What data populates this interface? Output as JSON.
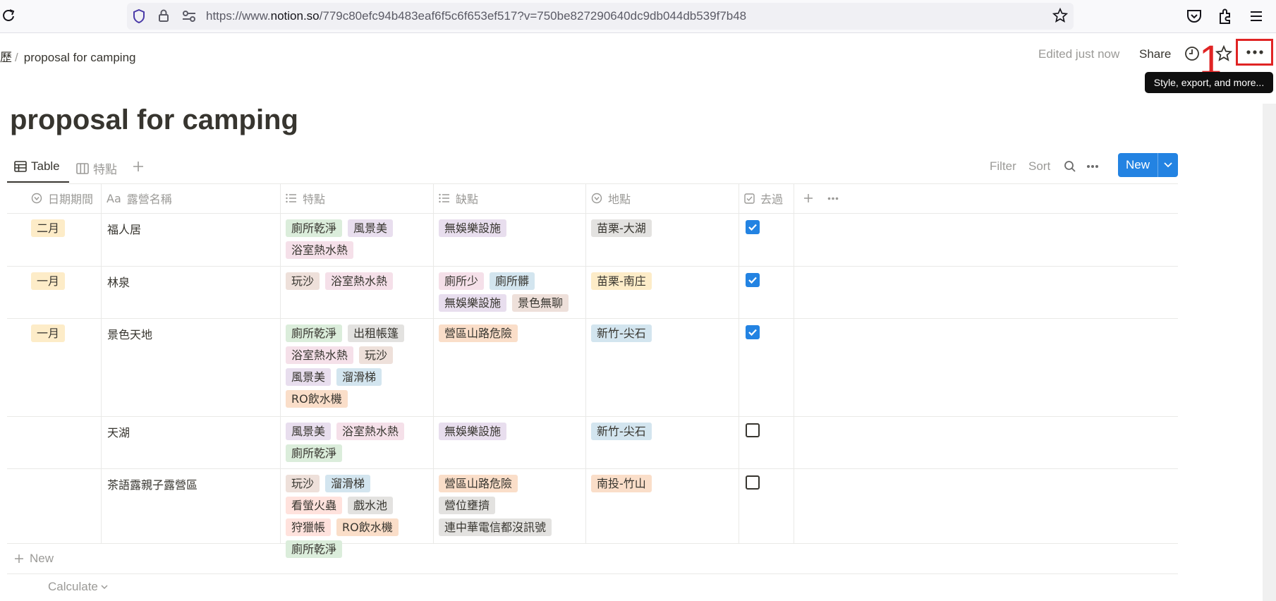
{
  "browser": {
    "url_prefix": "https://www.",
    "url_domain": "notion.so",
    "url_rest": "/779c80efc94b483eaf6f5c6f653ef517?v=750be827290640dc9db044db539f7b48"
  },
  "topbar": {
    "breadcrumb_prefix": "歷",
    "breadcrumb_sep": "/",
    "breadcrumb_page": "proposal for camping",
    "edited": "Edited just now",
    "share": "Share",
    "annotation_number": "1",
    "tooltip": "Style, export, and more..."
  },
  "page": {
    "title": "proposal for camping"
  },
  "views": {
    "tabs": [
      {
        "label": "Table"
      },
      {
        "label": "特點"
      }
    ],
    "filter": "Filter",
    "sort": "Sort",
    "new": "New"
  },
  "columns": [
    {
      "label": "日期期間",
      "icon": "status-icon"
    },
    {
      "label": "露營名稱",
      "icon": "title-icon",
      "prefix": "Aa"
    },
    {
      "label": "特點",
      "icon": "list-icon"
    },
    {
      "label": "缺點",
      "icon": "list-icon"
    },
    {
      "label": "地點",
      "icon": "status-icon"
    },
    {
      "label": "去過",
      "icon": "checkbox-icon"
    }
  ],
  "rows": [
    {
      "date": "二月",
      "name": "福人居",
      "pros": [
        "廁所乾淨",
        "風景美",
        "浴室熱水熱"
      ],
      "cons": [
        "無娛樂設施"
      ],
      "location": "苗栗-大湖",
      "visited": true
    },
    {
      "date": "一月",
      "name": "林泉",
      "pros": [
        "玩沙",
        "浴室熱水熱"
      ],
      "cons": [
        "廁所少",
        "廁所髒",
        "無娛樂設施",
        "景色無聊"
      ],
      "location": "苗栗-南庄",
      "visited": true
    },
    {
      "date": "一月",
      "name": "景色天地",
      "pros": [
        "廁所乾淨",
        "出租帳篷",
        "浴室熱水熱",
        "玩沙",
        "風景美",
        "溜滑梯",
        "RO飲水機"
      ],
      "cons": [
        "營區山路危險"
      ],
      "location": "新竹-尖石",
      "visited": true
    },
    {
      "date": "",
      "name": "天湖",
      "pros": [
        "風景美",
        "浴室熱水熱",
        "廁所乾淨"
      ],
      "cons": [
        "無娛樂設施"
      ],
      "location": "新竹-尖石",
      "visited": false
    },
    {
      "date": "",
      "name": "茶語露親子露營區",
      "pros": [
        "玩沙",
        "溜滑梯",
        "看螢火蟲",
        "戲水池",
        "狩獵帳",
        "RO飲水機",
        "廁所乾淨"
      ],
      "cons": [
        "營區山路危險",
        "營位壅擠",
        "連中華電信都沒訊號"
      ],
      "location": "南投-竹山",
      "visited": false
    }
  ],
  "tag_colors": {
    "二月": "#fdecc8",
    "一月": "#fdecc8",
    "廁所乾淨": "#dbeddb",
    "風景美": "#e8deee",
    "浴室熱水熱": "#f5e0e9",
    "玩沙": "#eee0da",
    "出租帳篷": "#e3e2e0",
    "溜滑梯": "#d3e5ef",
    "RO飲水機": "#fadec9",
    "看螢火蟲": "#ffe2dd",
    "戲水池": "#e3e2e0",
    "狩獵帳": "#ffe2dd",
    "無娛樂設施": "#e8deee",
    "廁所少": "#f5e0e9",
    "廁所髒": "#d3e5ef",
    "景色無聊": "#eee0da",
    "營區山路危險": "#fadec9",
    "營位壅擠": "#e3e2e0",
    "連中華電信都沒訊號": "#e3e2e0",
    "苗栗-大湖": "#e3e2e0",
    "苗栗-南庄": "#fdecc8",
    "新竹-尖石": "#d3e5ef",
    "南投-竹山": "#fadec9"
  },
  "footer": {
    "new": "New",
    "calculate": "Calculate"
  }
}
